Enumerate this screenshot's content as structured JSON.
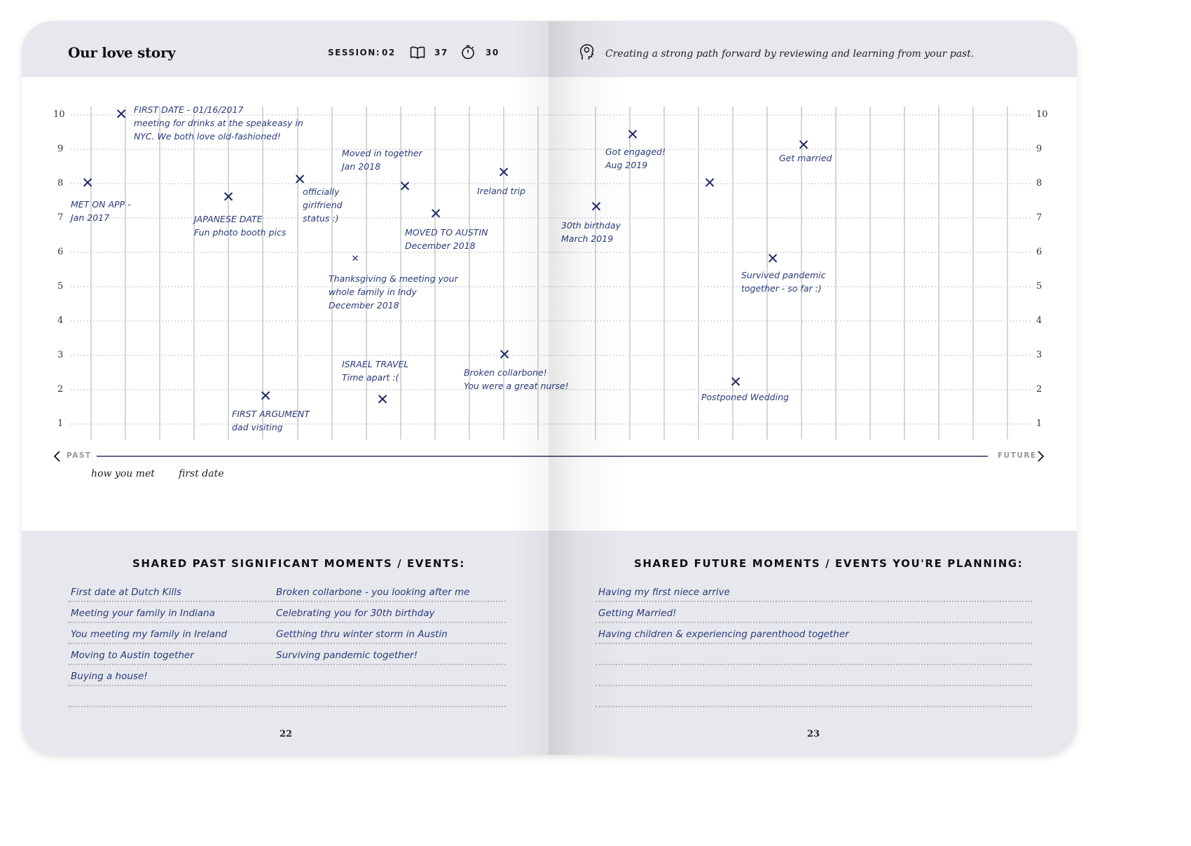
{
  "header": {
    "title": "Our love story",
    "session_label": "SESSION:",
    "session_value": "02",
    "book_value": "37",
    "timer_value": "30",
    "tagline": "Creating a strong path forward by reviewing and learning from your past.",
    "icons": [
      "book-icon",
      "stopwatch-icon",
      "head-lightbulb-icon"
    ]
  },
  "timeline": {
    "y_ticks": [
      "10",
      "9",
      "8",
      "7",
      "6",
      "5",
      "4",
      "3",
      "2",
      "1"
    ],
    "past_label": "PAST",
    "future_label": "FUTURE",
    "x_labels": [
      "how you met",
      "first date"
    ],
    "events": [
      {
        "lines": [
          "MET ON APP -",
          "Jan 2017"
        ],
        "value": 8
      },
      {
        "lines": [
          "FIRST DATE - 01/16/2017",
          "meeting for drinks at the speakeasy in",
          "NYC. We both love old-fashioned!"
        ],
        "value": 10
      },
      {
        "lines": [
          "JAPANESE DATE",
          "Fun photo booth pics"
        ],
        "value": 7.6
      },
      {
        "lines": [
          "FIRST ARGUMENT",
          "dad visiting"
        ],
        "value": 1.8
      },
      {
        "lines": [
          "officially",
          "girlfriend",
          "status :)"
        ],
        "value": 8.1
      },
      {
        "lines": [
          "Thanksgiving & meeting your",
          "whole family in Indy",
          "December 2018"
        ],
        "value": 5.8
      },
      {
        "lines": [
          "ISRAEL TRAVEL",
          "Time apart :("
        ],
        "value": 1.7
      },
      {
        "lines": [
          "Moved in together",
          "Jan 2018"
        ],
        "value": 7.9
      },
      {
        "lines": [
          "MOVED TO AUSTIN",
          "December 2018"
        ],
        "value": 7.1
      },
      {
        "lines": [
          "Ireland trip"
        ],
        "value": 8.3
      },
      {
        "lines": [
          "Broken collarbone!",
          "You were a great nurse!"
        ],
        "value": 3
      },
      {
        "lines": [
          "30th birthday",
          "March 2019"
        ],
        "value": 7.3
      },
      {
        "lines": [
          "Got engaged!",
          "Aug 2019"
        ],
        "value": 9.4
      },
      {
        "lines": [],
        "value": 8
      },
      {
        "lines": [
          "Postponed Wedding"
        ],
        "value": 2.2
      },
      {
        "lines": [
          "Survived pandemic",
          "together - so far :)"
        ],
        "value": 5.8
      },
      {
        "lines": [
          "Get married"
        ],
        "value": 9.1
      }
    ]
  },
  "past_section": {
    "heading": "SHARED PAST SIGNIFICANT MOMENTS / EVENTS:",
    "col1": [
      "First date at Dutch Kills",
      "Meeting your family in Indiana",
      "You meeting my family in Ireland",
      "Moving to Austin together",
      "Buying a house!",
      ""
    ],
    "col2": [
      "Broken collarbone - you looking after me",
      "Celebrating you for 30th birthday",
      "Getthing thru winter storm in Austin",
      "Surviving pandemic together!",
      "",
      ""
    ],
    "page_number": "22"
  },
  "future_section": {
    "heading": "SHARED FUTURE MOMENTS / EVENTS YOU'RE PLANNING:",
    "items": [
      "Having my first niece arrive",
      "Getting Married!",
      "Having children & experiencing parenthood together",
      "",
      "",
      ""
    ],
    "page_number": "23"
  },
  "colors": {
    "ink": "#2b3a7a",
    "band": "#e6e8ed",
    "grid": "#c9cbd1"
  }
}
